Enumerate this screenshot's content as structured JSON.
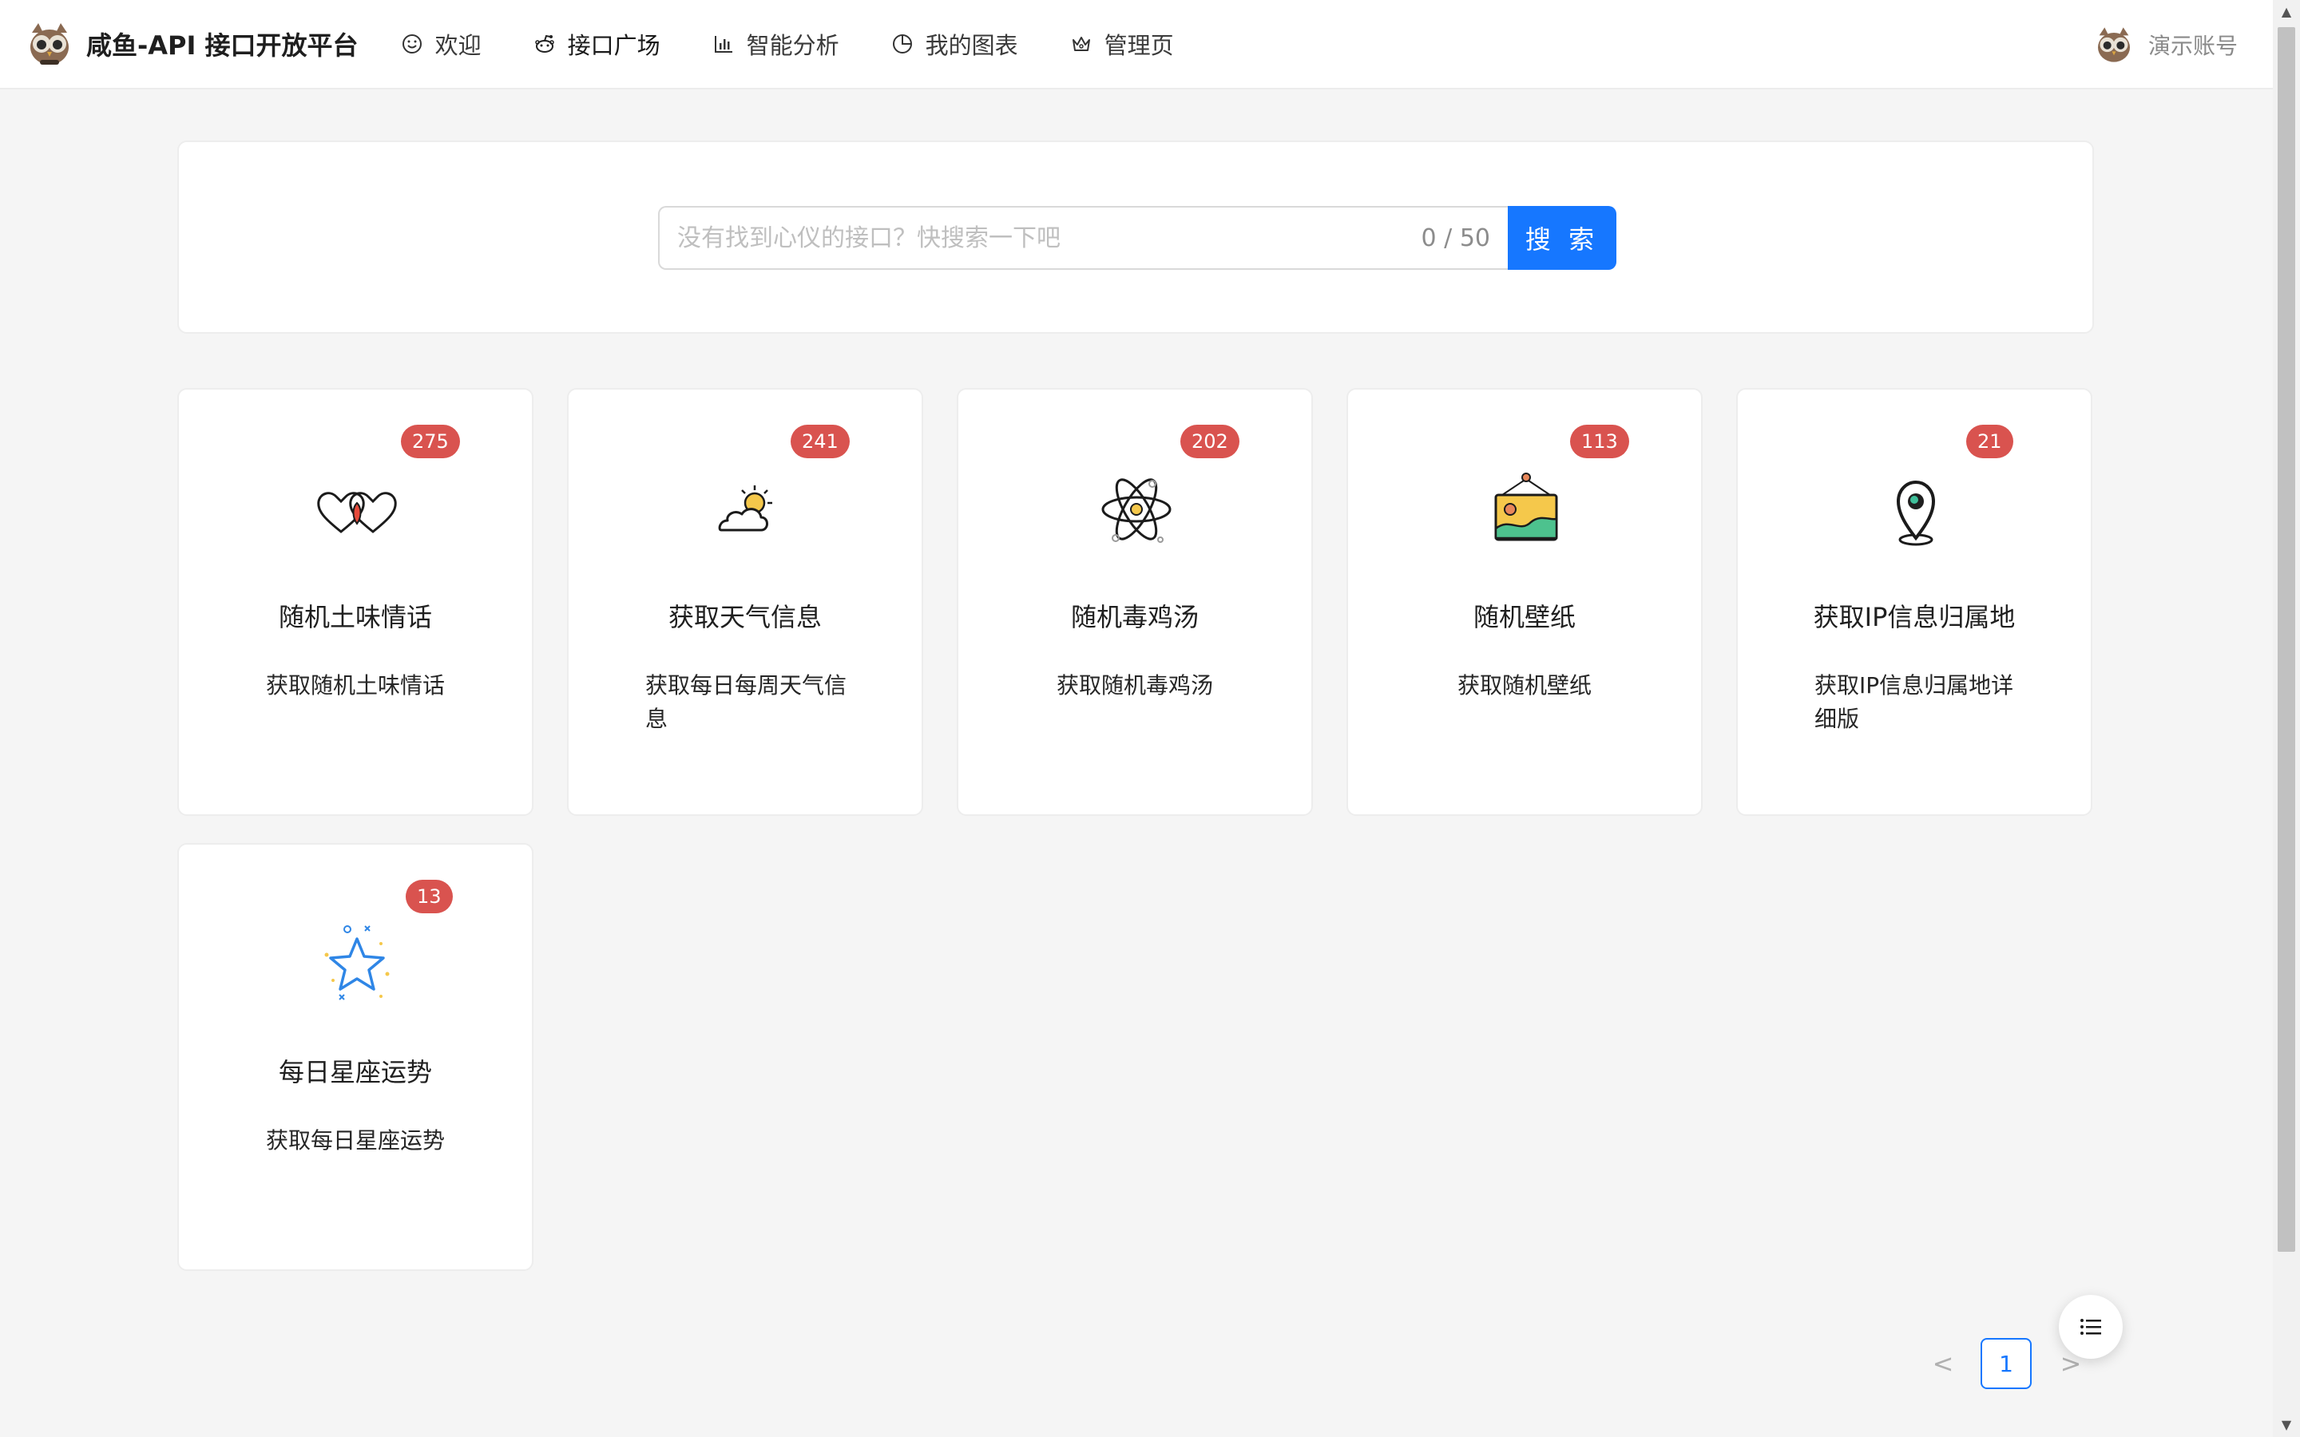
{
  "header": {
    "brand_title": "咸鱼-API 接口开放平台",
    "nav": [
      {
        "label": "欢迎",
        "icon": "smile-icon"
      },
      {
        "label": "接口广场",
        "icon": "reddit-icon"
      },
      {
        "label": "智能分析",
        "icon": "bar-chart-icon"
      },
      {
        "label": "我的图表",
        "icon": "pie-chart-icon"
      },
      {
        "label": "管理页",
        "icon": "crown-icon"
      }
    ],
    "active_nav": "接口广场",
    "user_name": "演示账号"
  },
  "search": {
    "placeholder": "没有找到心仪的接口？快搜索一下吧",
    "value": "",
    "count": "0 / 50",
    "button_label": "搜 索"
  },
  "cards": [
    {
      "count": "275",
      "title": "随机土味情话",
      "description": "获取随机土味情话",
      "icon": "hearts-icon"
    },
    {
      "count": "241",
      "title": "获取天气信息",
      "description": "获取每日每周天气信息",
      "icon": "weather-icon"
    },
    {
      "count": "202",
      "title": "随机毒鸡汤",
      "description": "获取随机毒鸡汤",
      "icon": "atom-icon"
    },
    {
      "count": "113",
      "title": "随机壁纸",
      "description": "获取随机壁纸",
      "icon": "picture-frame-icon"
    },
    {
      "count": "21",
      "title": "获取IP信息归属地",
      "description": "获取IP信息归属地详细版",
      "icon": "location-pin-icon"
    },
    {
      "count": "13",
      "title": "每日星座运势",
      "description": "获取每日星座运势",
      "icon": "star-icon"
    }
  ],
  "pagination": {
    "prev": "<",
    "current": "1",
    "next": ">"
  },
  "colors": {
    "primary": "#1677ff",
    "badge": "#d9534f"
  }
}
